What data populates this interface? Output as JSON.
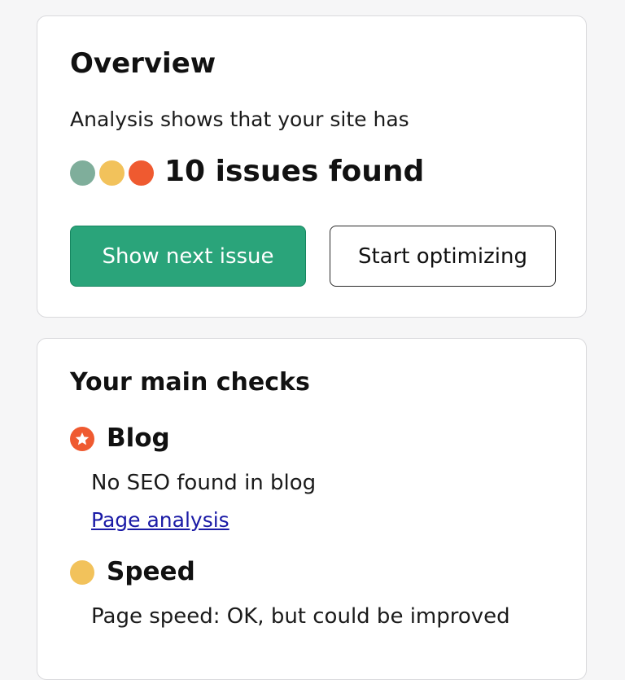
{
  "overview": {
    "title": "Overview",
    "subtitle": "Analysis shows that your site has",
    "issues_label": "10 issues found",
    "status_dots": [
      {
        "name": "teal-dot",
        "color": "#7fae9b"
      },
      {
        "name": "yellow-dot",
        "color": "#f2c25b"
      },
      {
        "name": "red-dot",
        "color": "#ef5a30"
      }
    ],
    "buttons": {
      "primary_label": "Show next issue",
      "secondary_label": "Start optimizing"
    },
    "colors": {
      "primary_button": "#2aa47a"
    }
  },
  "checks": {
    "title": "Your main checks",
    "items": [
      {
        "name": "Blog",
        "icon": "star-icon",
        "icon_color": "#ef5a30",
        "description": "No SEO found in blog",
        "link_label": "Page analysis"
      },
      {
        "name": "Speed",
        "icon": "circle-icon",
        "icon_color": "#f2c25b",
        "description": "Page speed: OK, but could be improved"
      }
    ]
  }
}
